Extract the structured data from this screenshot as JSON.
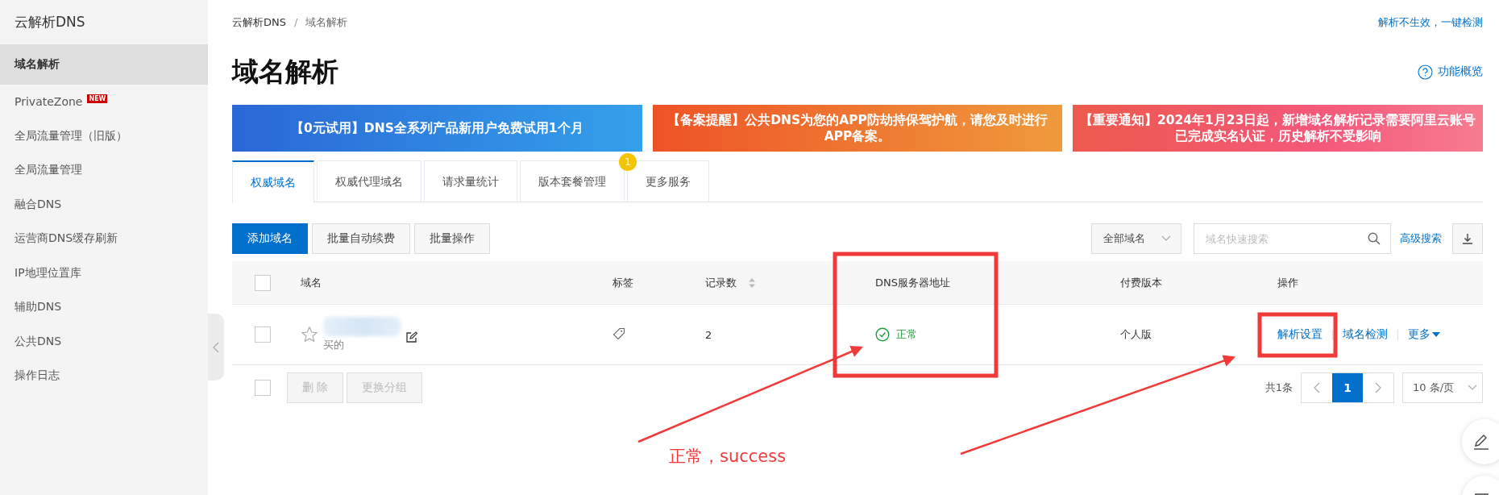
{
  "sidebar": {
    "title": "云解析DNS",
    "items": [
      {
        "label": "域名解析",
        "selected": true
      },
      {
        "label": "PrivateZone",
        "badge": "NEW",
        "selected": false
      },
      {
        "label": "全局流量管理（旧版）",
        "selected": false
      },
      {
        "label": "全局流量管理",
        "selected": false
      },
      {
        "label": "融合DNS",
        "selected": false
      },
      {
        "label": "运营商DNS缓存刷新",
        "selected": false
      },
      {
        "label": "IP地理位置库",
        "selected": false
      },
      {
        "label": "辅助DNS",
        "selected": false
      },
      {
        "label": "公共DNS",
        "selected": false
      },
      {
        "label": "操作日志",
        "selected": false
      }
    ]
  },
  "breadcrumb": [
    "云解析DNS",
    "域名解析"
  ],
  "breadcrumb_separator": "/",
  "top_link": "解析不生效，一键检测",
  "page_title": "域名解析",
  "help_link": "功能概览",
  "banners": [
    {
      "kind": "promo",
      "text": "【0元试用】DNS全系列产品新用户免费试用1个月"
    },
    {
      "kind": "reminder",
      "text": "【备案提醒】公共DNS为您的APP防劫持保驾护航，请您及时进行APP备案。"
    },
    {
      "kind": "notice",
      "text": "【重要通知】2024年1月23日起，新增域名解析记录需要阿里云账号已完成实名认证，历史解析不受影响"
    }
  ],
  "tabs": [
    {
      "label": "权威域名",
      "selected": true
    },
    {
      "label": "权威代理域名",
      "selected": false
    },
    {
      "label": "请求量统计",
      "selected": false
    },
    {
      "label": "版本套餐管理",
      "selected": false,
      "badge": "1"
    },
    {
      "label": "更多服务",
      "selected": false
    }
  ],
  "toolbar": {
    "primary": "添加域名",
    "buttons": [
      "批量自动续费",
      "批量操作"
    ],
    "filter": "全部域名",
    "search": {
      "placeholder": "域名快速搜索"
    },
    "advanced_link": "高级搜索"
  },
  "table": {
    "select_all": {
      "checked": false
    },
    "columns": [
      "域名",
      "标签",
      "记录数",
      "DNS服务器地址",
      "付费版本",
      "操作"
    ],
    "rows": [
      {
        "checked": false,
        "starred": false,
        "group": "买的",
        "records": "2",
        "dns_status": {
          "text": "正常",
          "ok": true
        },
        "edition": "个人版",
        "actions": [
          "解析设置",
          "域名检测",
          "更多"
        ]
      }
    ]
  },
  "footer": {
    "select_all": {
      "checked": false
    },
    "buttons": [
      {
        "label": "删 除",
        "disabled": true
      },
      {
        "label": "更换分组",
        "disabled": true
      }
    ],
    "total": "共1条",
    "pages": [
      {
        "label": "1",
        "selected": true
      }
    ],
    "page_size": "10 条/页"
  },
  "annotation": {
    "text": "正常，success"
  }
}
